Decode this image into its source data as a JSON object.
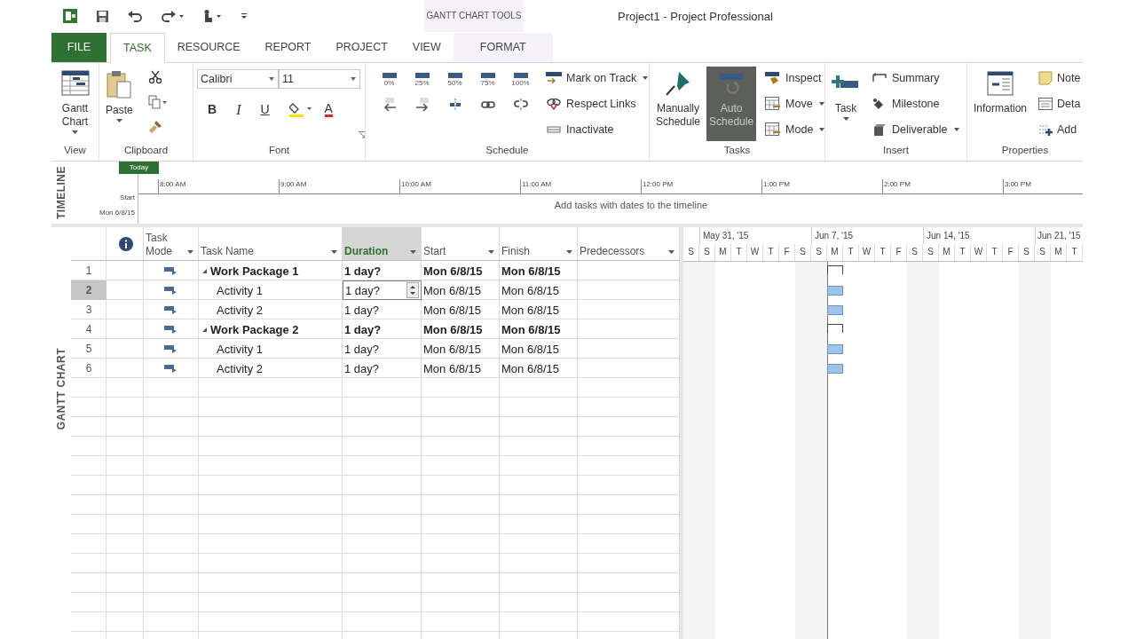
{
  "title_bar": {
    "context_label": "GANTT CHART TOOLS",
    "title": "Project1 - Project Professional"
  },
  "tabs": [
    {
      "label": "FILE",
      "kind": "file",
      "selected": false
    },
    {
      "label": "TASK",
      "kind": "normal",
      "selected": true
    },
    {
      "label": "RESOURCE",
      "kind": "normal",
      "selected": false
    },
    {
      "label": "REPORT",
      "kind": "normal",
      "selected": false
    },
    {
      "label": "PROJECT",
      "kind": "normal",
      "selected": false
    },
    {
      "label": "VIEW",
      "kind": "normal",
      "selected": false
    },
    {
      "label": "FORMAT",
      "kind": "contextual",
      "selected": false
    }
  ],
  "ribbon": {
    "view": {
      "label": "View",
      "gantt_chart": "Gantt Chart"
    },
    "clipboard": {
      "label": "Clipboard",
      "paste": "Paste"
    },
    "font": {
      "label": "Font",
      "family": "Calibri",
      "size": "11",
      "bold": "B",
      "italic": "I",
      "underline": "U",
      "font_color": "A"
    },
    "schedule": {
      "label": "Schedule",
      "percent": [
        "0%",
        "25%",
        "50%",
        "75%",
        "100%"
      ],
      "commands": [
        "Mark on Track",
        "Respect Links",
        "Inactivate"
      ]
    },
    "tasks": {
      "label": "Tasks",
      "modes": [
        {
          "label": "Manually Schedule",
          "selected": false
        },
        {
          "label": "Auto Schedule",
          "selected": true
        }
      ],
      "commands": [
        "Inspect",
        "Move",
        "Mode"
      ]
    },
    "insert": {
      "label": "Insert",
      "task": "Task",
      "commands": [
        "Summary",
        "Milestone",
        "Deliverable"
      ]
    },
    "properties": {
      "label": "Properties",
      "information": "Information",
      "commands": [
        "Note",
        "Deta",
        "Add"
      ]
    }
  },
  "timeline": {
    "side_label": "TIMELINE",
    "today": "Today",
    "start_label": "Start",
    "start_date": "Mon 6/8/15",
    "ticks": [
      "8:00 AM",
      "9:00 AM",
      "10:00 AM",
      "11:00 AM",
      "12:00 PM",
      "1:00 PM",
      "2:00 PM",
      "3:00 PM"
    ],
    "hint": "Add tasks with dates to the timeline"
  },
  "gantt": {
    "side_label": "GANTT CHART",
    "columns": [
      {
        "label": "Task Mode",
        "selected": false
      },
      {
        "label": "Task Name",
        "selected": false
      },
      {
        "label": "Duration",
        "selected": true
      },
      {
        "label": "Start",
        "selected": false
      },
      {
        "label": "Finish",
        "selected": false
      },
      {
        "label": "Predecessors",
        "selected": false
      }
    ],
    "rows": [
      {
        "id": "1",
        "name": "Work Package 1",
        "summary": true,
        "duration": "1 day?",
        "start": "Mon 6/8/15",
        "finish": "Mon 6/8/15",
        "selected": false
      },
      {
        "id": "2",
        "name": "Activity 1",
        "summary": false,
        "duration": "1 day?",
        "start": "Mon 6/8/15",
        "finish": "Mon 6/8/15",
        "selected": true
      },
      {
        "id": "3",
        "name": "Activity 2",
        "summary": false,
        "duration": "1 day?",
        "start": "Mon 6/8/15",
        "finish": "Mon 6/8/15",
        "selected": false
      },
      {
        "id": "4",
        "name": "Work Package 2",
        "summary": true,
        "duration": "1 day?",
        "start": "Mon 6/8/15",
        "finish": "Mon 6/8/15",
        "selected": false
      },
      {
        "id": "5",
        "name": "Activity 1",
        "summary": false,
        "duration": "1 day?",
        "start": "Mon 6/8/15",
        "finish": "Mon 6/8/15",
        "selected": false
      },
      {
        "id": "6",
        "name": "Activity 2",
        "summary": false,
        "duration": "1 day?",
        "start": "Mon 6/8/15",
        "finish": "Mon 6/8/15",
        "selected": false
      }
    ],
    "weeks": [
      "May 31, '15",
      "Jun 7, '15",
      "Jun 14, '15",
      "Jun 21, '15"
    ],
    "days": [
      "S",
      "S",
      "M",
      "T",
      "W",
      "T",
      "F",
      "S",
      "S",
      "M",
      "T",
      "W",
      "T",
      "F",
      "S",
      "S",
      "M",
      "T",
      "W",
      "T",
      "F",
      "S",
      "S",
      "M",
      "T"
    ]
  }
}
